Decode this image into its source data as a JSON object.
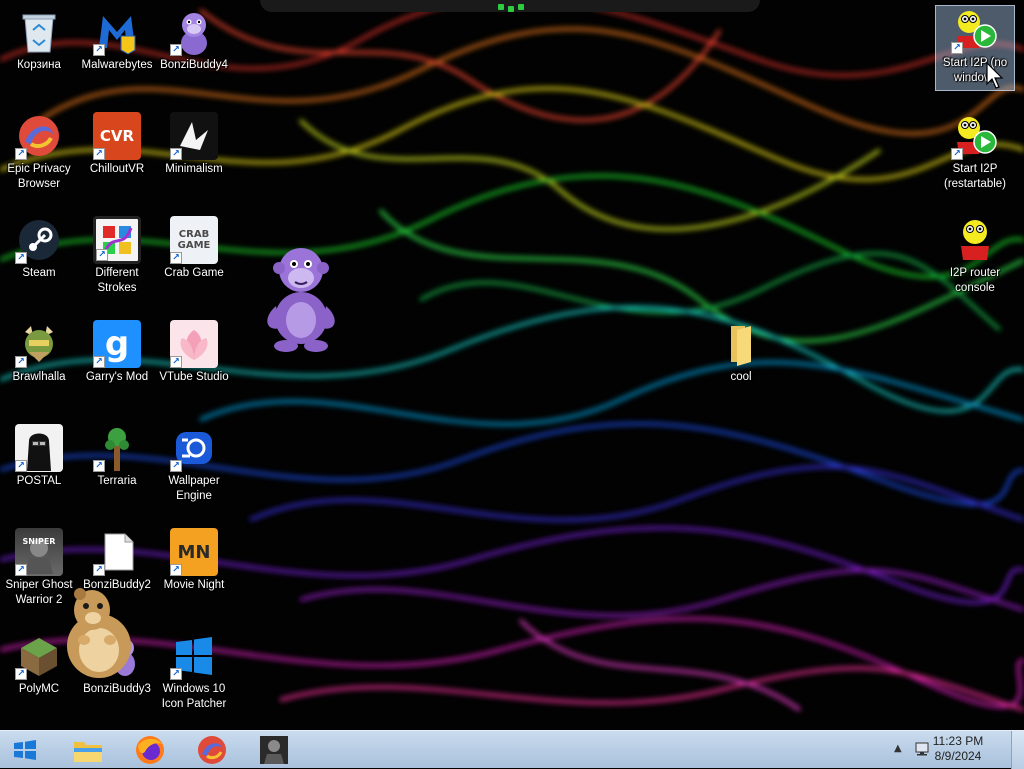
{
  "desktop": {
    "icons": [
      {
        "label": "Корзина",
        "icon": "recycle-bin-icon"
      },
      {
        "label": "Malwarebytes",
        "icon": "malwarebytes-icon"
      },
      {
        "label": "BonziBuddy4",
        "icon": "bonzibuddy-icon"
      },
      {
        "label": "Epic Privacy Browser",
        "icon": "epic-browser-icon"
      },
      {
        "label": "ChilloutVR",
        "icon": "chilloutvr-icon",
        "text": "CVR"
      },
      {
        "label": "Minimalism",
        "icon": "minimalism-icon"
      },
      {
        "label": "Steam",
        "icon": "steam-icon"
      },
      {
        "label": "Different Strokes",
        "icon": "different-strokes-icon"
      },
      {
        "label": "Crab Game",
        "icon": "crab-game-icon",
        "text": "CRAB GAME"
      },
      {
        "label": "Brawlhalla",
        "icon": "brawlhalla-icon"
      },
      {
        "label": "Garry's Mod",
        "icon": "garrys-mod-icon",
        "text": "g"
      },
      {
        "label": "VTube Studio",
        "icon": "vtube-studio-icon"
      },
      {
        "label": "POSTAL",
        "icon": "postal-icon"
      },
      {
        "label": "Terraria",
        "icon": "terraria-icon"
      },
      {
        "label": "Wallpaper Engine",
        "icon": "wallpaper-engine-icon"
      },
      {
        "label": "Sniper Ghost Warrior 2",
        "icon": "sniper-ghost-warrior-icon"
      },
      {
        "label": "BonziBuddy2",
        "icon": "bonzibuddy-file-icon"
      },
      {
        "label": "Movie Night",
        "icon": "movie-night-icon",
        "text": "MN"
      },
      {
        "label": "PolyMC",
        "icon": "polymc-icon"
      },
      {
        "label": "BonziBuddy3",
        "icon": "bonzibuddy-icon"
      },
      {
        "label": "Windows 10 Icon Patcher",
        "icon": "windows-logo-icon"
      },
      {
        "label": "cool",
        "icon": "folder-icon"
      },
      {
        "label": "Start I2P (no window)",
        "icon": "i2p-start-icon"
      },
      {
        "label": "Start I2P (restartable)",
        "icon": "i2p-start-icon"
      },
      {
        "label": "I2P router console",
        "icon": "i2p-console-icon"
      }
    ]
  },
  "taskbar": {
    "pinned": [
      {
        "name": "file-explorer"
      },
      {
        "name": "firefox"
      },
      {
        "name": "epic-browser"
      },
      {
        "name": "sniper-ghost-warrior"
      }
    ],
    "clock": {
      "time": "11:23 PM",
      "date": "8/9/2024"
    },
    "tray_arrow": "▲"
  },
  "colors": {
    "taskbar_top": "#c9dbee",
    "taskbar_bottom": "#a9c1dc",
    "selection": "#aac8eb"
  }
}
